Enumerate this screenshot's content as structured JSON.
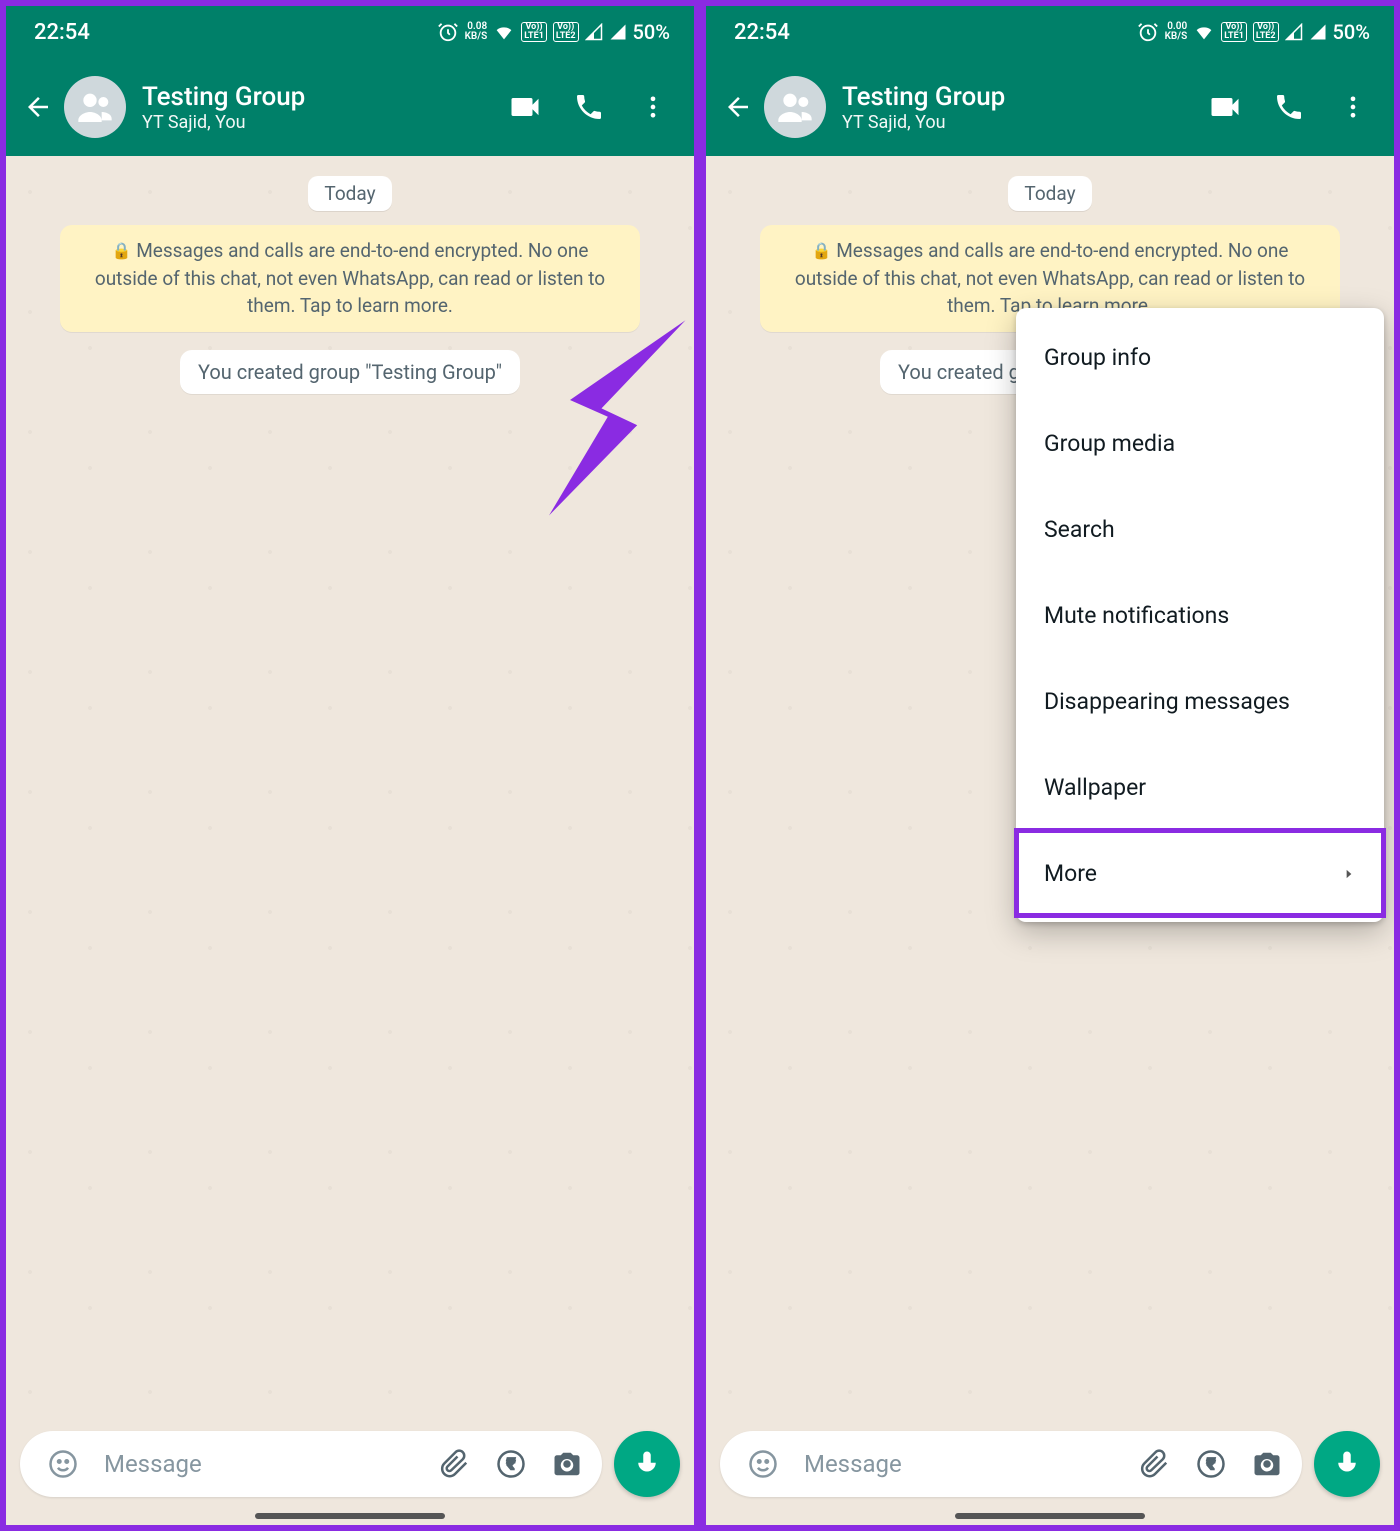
{
  "status": {
    "time": "22:54",
    "kbs_left": "0.08",
    "kbs_right": "0.00",
    "kbs_unit": "KB/S",
    "lte1": "Vo))",
    "lte1b": "LTE1",
    "lte2": "Vo))",
    "lte2b": "LTE2",
    "battery": "50%"
  },
  "appbar": {
    "title": "Testing Group",
    "subtitle": "YT Sajid, You"
  },
  "chips": {
    "date": "Today"
  },
  "banner": {
    "text": "Messages and calls are end-to-end encrypted. No one outside of this chat, not even WhatsApp, can read or listen to them. Tap to learn more."
  },
  "system": {
    "created": "You created group \"Testing Group\""
  },
  "composer": {
    "placeholder": "Message"
  },
  "menu": {
    "items": {
      "info": "Group info",
      "media": "Group media",
      "search": "Search",
      "mute": "Mute notifications",
      "disappearing": "Disappearing messages",
      "wallpaper": "Wallpaper",
      "more": "More"
    }
  }
}
